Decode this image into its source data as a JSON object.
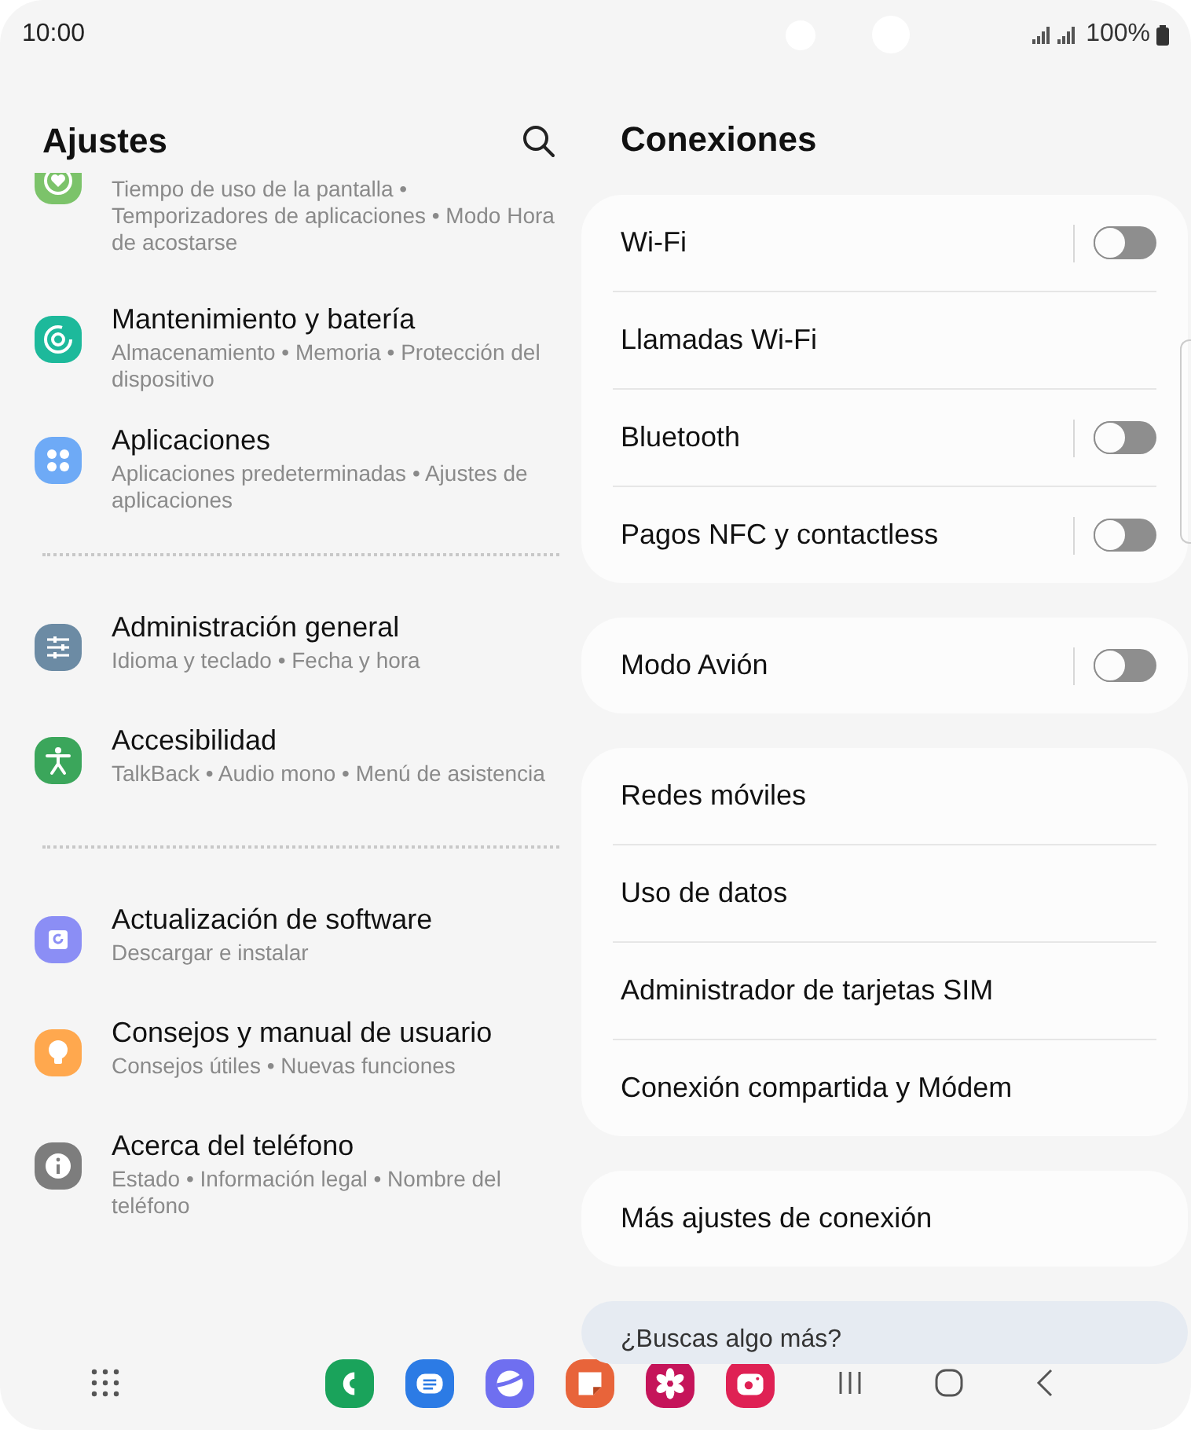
{
  "status_bar": {
    "time": "10:00",
    "battery": "100%"
  },
  "settings": {
    "title": "Ajustes",
    "groups": [
      [
        {
          "subtitle": "Tiempo de uso de la pantalla • Temporizadores de aplicaciones • Modo Hora de acostarse"
        },
        {
          "title": "Mantenimiento y batería",
          "subtitle": "Almacenamiento • Memoria • Protección del dispositivo"
        },
        {
          "title": "Aplicaciones",
          "subtitle": "Aplicaciones predeterminadas • Ajustes de aplicaciones"
        }
      ],
      [
        {
          "title": "Administración general",
          "subtitle": "Idioma y teclado • Fecha y hora"
        },
        {
          "title": "Accesibilidad",
          "subtitle": "TalkBack • Audio mono • Menú de asistencia"
        }
      ],
      [
        {
          "title": "Actualización de software",
          "subtitle": "Descargar e instalar"
        },
        {
          "title": "Consejos y manual de usuario",
          "subtitle": "Consejos útiles • Nuevas funciones"
        },
        {
          "title": "Acerca del teléfono",
          "subtitle": "Estado • Información legal • Nombre del teléfono"
        }
      ]
    ]
  },
  "connections": {
    "title": "Conexiones",
    "cards": [
      {
        "rows": [
          {
            "label": "Wi-Fi",
            "kind": "switch",
            "on": false
          },
          {
            "label": "Llamadas Wi-Fi",
            "kind": "link"
          },
          {
            "label": "Bluetooth",
            "kind": "switch",
            "on": false
          },
          {
            "label": "Pagos NFC y contactless",
            "kind": "switch",
            "on": false
          }
        ]
      },
      {
        "rows": [
          {
            "label": "Modo Avión",
            "kind": "switch",
            "on": false
          }
        ]
      },
      {
        "rows": [
          {
            "label": "Redes móviles",
            "kind": "link"
          },
          {
            "label": "Uso de datos",
            "kind": "link"
          },
          {
            "label": "Administrador de tarjetas SIM",
            "kind": "link"
          },
          {
            "label": "Conexión compartida y Módem",
            "kind": "link"
          }
        ]
      },
      {
        "rows": [
          {
            "label": "Más ajustes de conexión",
            "kind": "link"
          }
        ]
      }
    ],
    "suggestion": {
      "title": "¿Buscas algo más?"
    }
  }
}
